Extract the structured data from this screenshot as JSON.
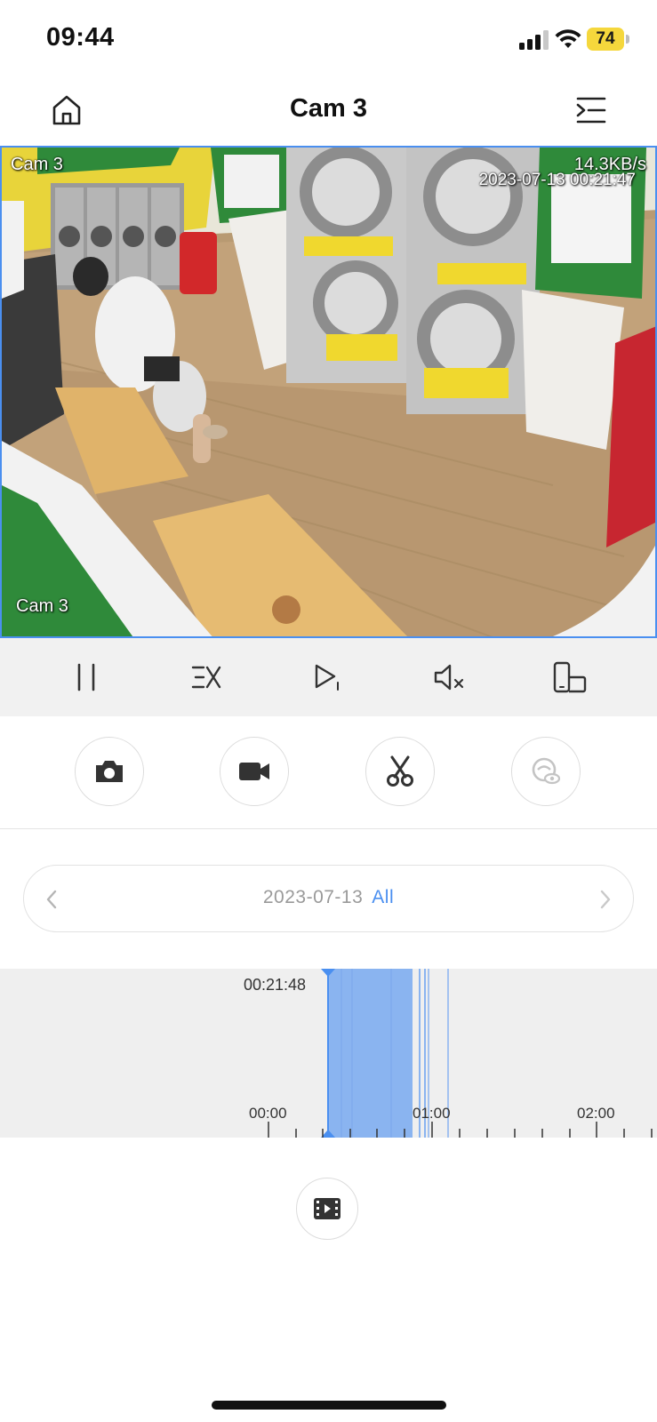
{
  "status": {
    "time": "09:44",
    "battery": "74",
    "icons": [
      "cellular-signal-icon",
      "wifi-icon",
      "battery-icon"
    ]
  },
  "nav": {
    "title": "Cam 3",
    "icons": [
      "home-icon",
      "menu-collapse-icon"
    ]
  },
  "video": {
    "osd_top_left": "Cam 3",
    "osd_bitrate": "14.3KB/s",
    "osd_timestamp": "2023-07-13 00:21:47",
    "osd_bottom_left": "Cam 3",
    "frame_border_color": "#4a8ff0"
  },
  "controls": {
    "items": [
      "pause-icon",
      "speed-x-icon",
      "play-single-icon",
      "mute-icon",
      "rotate-screen-icon"
    ]
  },
  "actions": {
    "items": [
      "snapshot-camera-icon",
      "record-video-icon",
      "clip-scissors-icon",
      "private-mode-icon"
    ],
    "disabled": [
      "private-mode-icon"
    ]
  },
  "date_nav": {
    "date": "2023-07-13",
    "filter": "All",
    "accent_color": "#4a8ff0"
  },
  "timeline": {
    "cursor_time": "00:21:48",
    "tick_labels": [
      "00:00",
      "01:00",
      "02:00"
    ],
    "recording_color": "#8ab4f0",
    "cursor_color": "#4a8ff0"
  },
  "footer": {
    "icons": [
      "video-clips-icon"
    ]
  }
}
